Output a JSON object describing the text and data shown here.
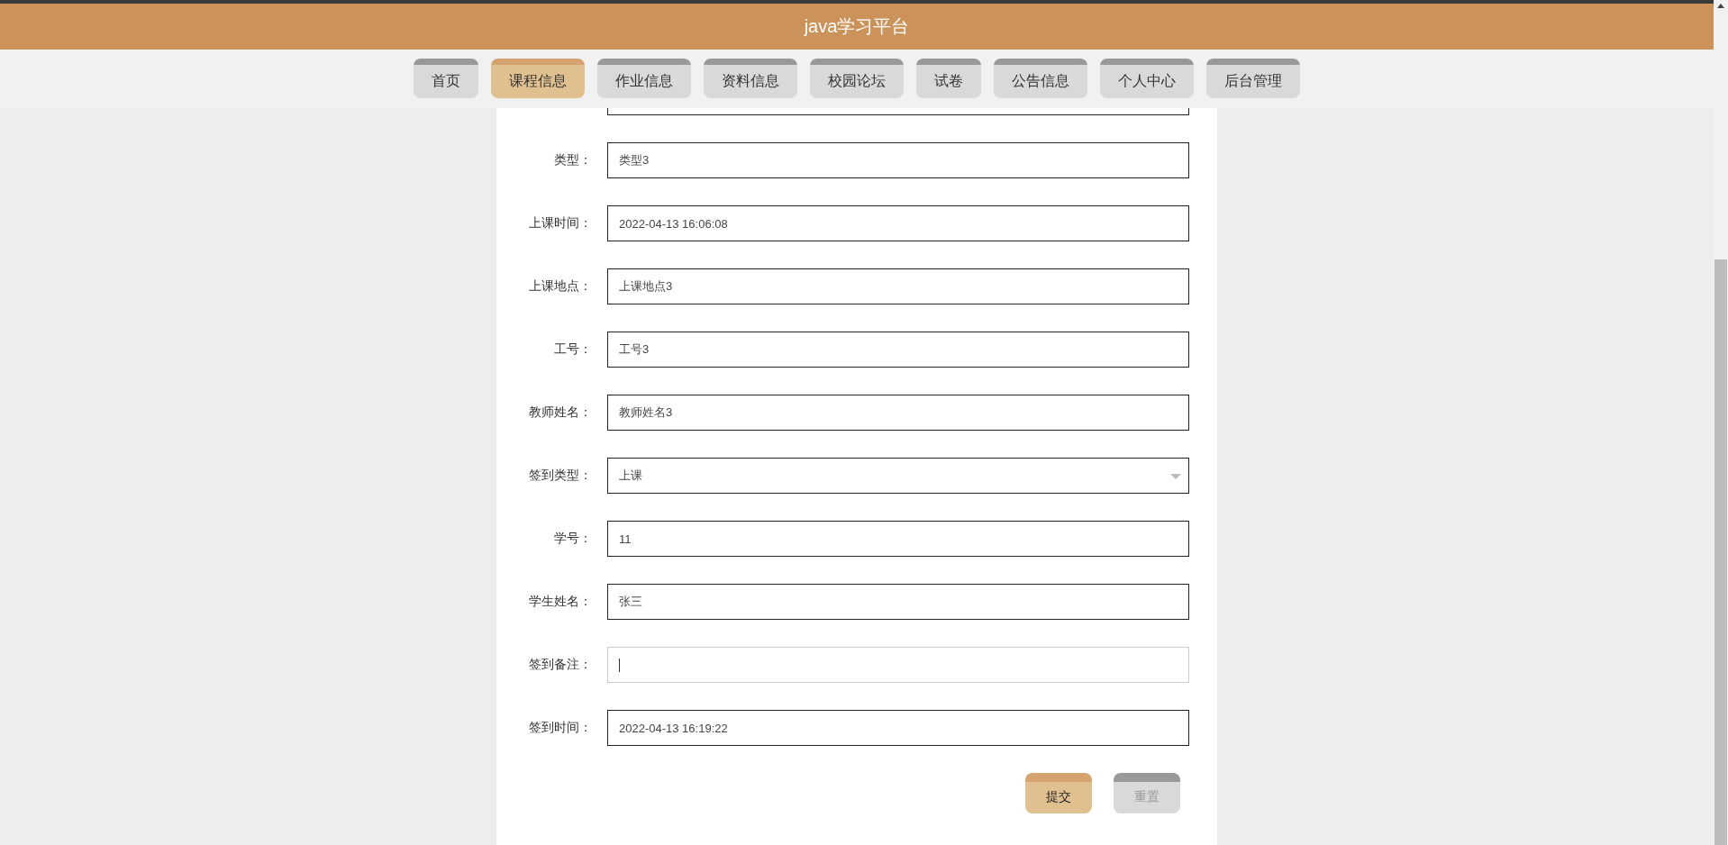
{
  "header": {
    "title": "java学习平台"
  },
  "nav": [
    {
      "label": "首页",
      "selected": false
    },
    {
      "label": "课程信息",
      "selected": true
    },
    {
      "label": "作业信息",
      "selected": false
    },
    {
      "label": "资料信息",
      "selected": false
    },
    {
      "label": "校园论坛",
      "selected": false
    },
    {
      "label": "试卷",
      "selected": false
    },
    {
      "label": "公告信息",
      "selected": false
    },
    {
      "label": "个人中心",
      "selected": false
    },
    {
      "label": "后台管理",
      "selected": false
    }
  ],
  "form": {
    "fields": [
      {
        "label": "类型：",
        "kind": "text",
        "value": "类型3",
        "focused": false
      },
      {
        "label": "上课时间：",
        "kind": "text",
        "value": "2022-04-13 16:06:08",
        "focused": false
      },
      {
        "label": "上课地点：",
        "kind": "text",
        "value": "上课地点3",
        "focused": false
      },
      {
        "label": "工号：",
        "kind": "text",
        "value": "工号3",
        "focused": false
      },
      {
        "label": "教师姓名：",
        "kind": "text",
        "value": "教师姓名3",
        "focused": false
      },
      {
        "label": "签到类型：",
        "kind": "select",
        "value": "上课",
        "focused": false
      },
      {
        "label": "学号：",
        "kind": "text",
        "value": "11",
        "focused": false
      },
      {
        "label": "学生姓名：",
        "kind": "text",
        "value": "张三",
        "focused": false
      },
      {
        "label": "签到备注：",
        "kind": "text",
        "focused": true
      },
      {
        "label": "签到时间：",
        "kind": "text",
        "value": "2022-04-13 16:19:22",
        "focused": false
      }
    ],
    "buttons": [
      {
        "label": "提交",
        "kind": "primary"
      },
      {
        "label": "重置",
        "kind": "secondary"
      }
    ]
  }
}
